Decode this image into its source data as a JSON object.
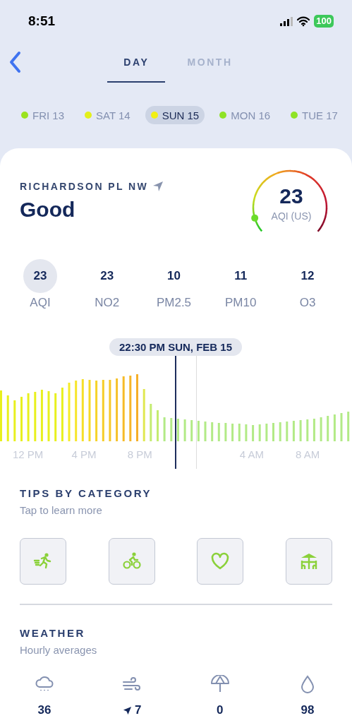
{
  "status_bar": {
    "time": "8:51",
    "battery": "100"
  },
  "tabs": [
    {
      "label": "DAY",
      "selected": true
    },
    {
      "label": "MONTH",
      "selected": false
    }
  ],
  "days": [
    {
      "label": "FRI 13",
      "color": "#9be31f",
      "selected": false
    },
    {
      "label": "SAT 14",
      "color": "#e3f01a",
      "selected": false
    },
    {
      "label": "SUN 15",
      "color": "#f2f014",
      "selected": true
    },
    {
      "label": "MON 16",
      "color": "#8fe326",
      "selected": false
    },
    {
      "label": "TUE 17",
      "color": "#8fe326",
      "selected": false
    }
  ],
  "location": {
    "name": "RICHARDSON PL NW",
    "category": "Good"
  },
  "gauge": {
    "value": "23",
    "unit": "AQI (US)",
    "level": 0.09
  },
  "pollutants": [
    {
      "value": "23",
      "label": "AQI",
      "selected": true
    },
    {
      "value": "23",
      "label": "NO2",
      "selected": false
    },
    {
      "value": "10",
      "label": "PM2.5",
      "selected": false
    },
    {
      "value": "11",
      "label": "PM10",
      "selected": false
    },
    {
      "value": "12",
      "label": "O3",
      "selected": false
    }
  ],
  "chart": {
    "tooltip": "22:30 PM SUN, FEB 15",
    "x_labels": [
      "12 PM",
      "4 PM",
      "8 PM",
      "4 AM",
      "8 AM"
    ]
  },
  "tips": {
    "title": "TIPS BY CATEGORY",
    "subtitle": "Tap to learn more",
    "buttons": [
      {
        "kind": "running"
      },
      {
        "kind": "cycling"
      },
      {
        "kind": "heart"
      },
      {
        "kind": "outdoor"
      }
    ]
  },
  "weather": {
    "title": "WEATHER",
    "subtitle": "Hourly averages",
    "items": [
      {
        "kind": "rain",
        "value": "36"
      },
      {
        "kind": "wind",
        "value": "7"
      },
      {
        "kind": "umbrella",
        "value": "0"
      },
      {
        "kind": "humidity",
        "value": "98"
      }
    ]
  }
}
